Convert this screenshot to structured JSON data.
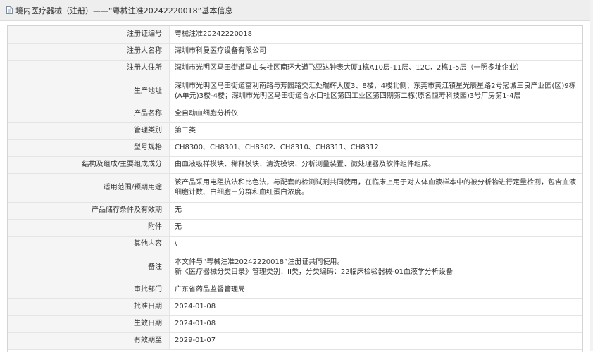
{
  "header": {
    "title": "境内医疗器械（注册）——“粤械注准20242220018”基本信息",
    "icon": "document-icon"
  },
  "rows": [
    {
      "label": "注册证编号",
      "value": "粤械注准20242220018"
    },
    {
      "label": "注册人名称",
      "value": "深圳市科曼医疗设备有限公司"
    },
    {
      "label": "注册人住所",
      "value": "深圳市光明区马田街道马山头社区南环大道飞亚达钟表大厦1栋A10层-11层、12C，2栋1-5层（一照多址企业）"
    },
    {
      "label": "生产地址",
      "value": "深圳市光明区马田街道富利南路与芳园路交汇处瑞辉大厦3、8楼，4楼北侧；东莞市黄江镇星光辰星路2号冠城三良产业园(区)9栋(A单元)3楼-4楼；深圳市光明区马田街道合水口社区第四工业区第四期第二栋(原名恒寿科技园)3号厂房第1-4层"
    },
    {
      "label": "产品名称",
      "value": "全自动血细胞分析仪"
    },
    {
      "label": "管理类别",
      "value": "第二类"
    },
    {
      "label": "型号规格",
      "value": "CH8300、CH8301、CH8302、CH8310、CH8311、CH8312"
    },
    {
      "label": "结构及组成/主要组成成分",
      "value": "由血液吸样模块、稀释模块、清洗模块、分析测量装置、微处理器及软件组件组成。"
    },
    {
      "label": "适用范围/预期用途",
      "value": "该产品采用电阻抗法和比色法，与配套的检测试剂共同使用，在临床上用于对人体血液样本中的被分析物进行定量检测，包含血液细胞计数、白细胞三分群和血红蛋白浓度。"
    },
    {
      "label": "产品储存条件及有效期",
      "value": "无"
    },
    {
      "label": "附件",
      "value": "无"
    },
    {
      "label": "其他内容",
      "value": "\\"
    },
    {
      "label": "备注",
      "value": "本文件与“粤械注准20242220018”注册证共同使用。\n新《医疗器械分类目录》管理类别：II类，分类编码：22临床检验器械-01血液学分析设备"
    },
    {
      "label": "审批部门",
      "value": "广东省药品监督管理局"
    },
    {
      "label": "批准日期",
      "value": "2024-01-08"
    },
    {
      "label": "生效日期",
      "value": "2024-01-08"
    },
    {
      "label": "有效期至",
      "value": "2029-01-07"
    }
  ]
}
